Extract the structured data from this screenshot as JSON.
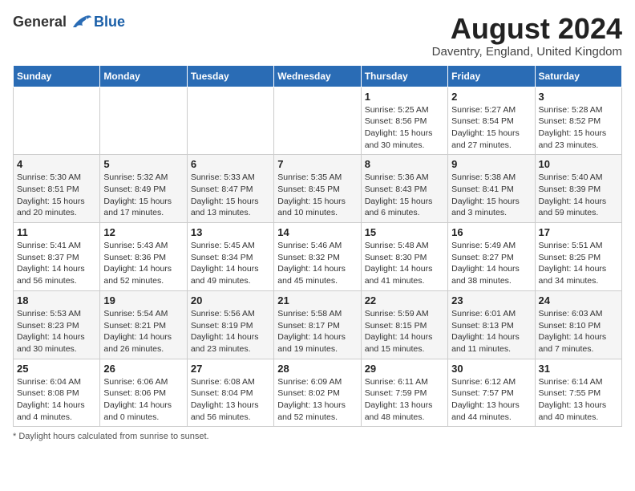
{
  "logo": {
    "general": "General",
    "blue": "Blue"
  },
  "header": {
    "month": "August 2024",
    "location": "Daventry, England, United Kingdom"
  },
  "days_of_week": [
    "Sunday",
    "Monday",
    "Tuesday",
    "Wednesday",
    "Thursday",
    "Friday",
    "Saturday"
  ],
  "weeks": [
    [
      {
        "day": "",
        "info": ""
      },
      {
        "day": "",
        "info": ""
      },
      {
        "day": "",
        "info": ""
      },
      {
        "day": "",
        "info": ""
      },
      {
        "day": "1",
        "info": "Sunrise: 5:25 AM\nSunset: 8:56 PM\nDaylight: 15 hours and 30 minutes."
      },
      {
        "day": "2",
        "info": "Sunrise: 5:27 AM\nSunset: 8:54 PM\nDaylight: 15 hours and 27 minutes."
      },
      {
        "day": "3",
        "info": "Sunrise: 5:28 AM\nSunset: 8:52 PM\nDaylight: 15 hours and 23 minutes."
      }
    ],
    [
      {
        "day": "4",
        "info": "Sunrise: 5:30 AM\nSunset: 8:51 PM\nDaylight: 15 hours and 20 minutes."
      },
      {
        "day": "5",
        "info": "Sunrise: 5:32 AM\nSunset: 8:49 PM\nDaylight: 15 hours and 17 minutes."
      },
      {
        "day": "6",
        "info": "Sunrise: 5:33 AM\nSunset: 8:47 PM\nDaylight: 15 hours and 13 minutes."
      },
      {
        "day": "7",
        "info": "Sunrise: 5:35 AM\nSunset: 8:45 PM\nDaylight: 15 hours and 10 minutes."
      },
      {
        "day": "8",
        "info": "Sunrise: 5:36 AM\nSunset: 8:43 PM\nDaylight: 15 hours and 6 minutes."
      },
      {
        "day": "9",
        "info": "Sunrise: 5:38 AM\nSunset: 8:41 PM\nDaylight: 15 hours and 3 minutes."
      },
      {
        "day": "10",
        "info": "Sunrise: 5:40 AM\nSunset: 8:39 PM\nDaylight: 14 hours and 59 minutes."
      }
    ],
    [
      {
        "day": "11",
        "info": "Sunrise: 5:41 AM\nSunset: 8:37 PM\nDaylight: 14 hours and 56 minutes."
      },
      {
        "day": "12",
        "info": "Sunrise: 5:43 AM\nSunset: 8:36 PM\nDaylight: 14 hours and 52 minutes."
      },
      {
        "day": "13",
        "info": "Sunrise: 5:45 AM\nSunset: 8:34 PM\nDaylight: 14 hours and 49 minutes."
      },
      {
        "day": "14",
        "info": "Sunrise: 5:46 AM\nSunset: 8:32 PM\nDaylight: 14 hours and 45 minutes."
      },
      {
        "day": "15",
        "info": "Sunrise: 5:48 AM\nSunset: 8:30 PM\nDaylight: 14 hours and 41 minutes."
      },
      {
        "day": "16",
        "info": "Sunrise: 5:49 AM\nSunset: 8:27 PM\nDaylight: 14 hours and 38 minutes."
      },
      {
        "day": "17",
        "info": "Sunrise: 5:51 AM\nSunset: 8:25 PM\nDaylight: 14 hours and 34 minutes."
      }
    ],
    [
      {
        "day": "18",
        "info": "Sunrise: 5:53 AM\nSunset: 8:23 PM\nDaylight: 14 hours and 30 minutes."
      },
      {
        "day": "19",
        "info": "Sunrise: 5:54 AM\nSunset: 8:21 PM\nDaylight: 14 hours and 26 minutes."
      },
      {
        "day": "20",
        "info": "Sunrise: 5:56 AM\nSunset: 8:19 PM\nDaylight: 14 hours and 23 minutes."
      },
      {
        "day": "21",
        "info": "Sunrise: 5:58 AM\nSunset: 8:17 PM\nDaylight: 14 hours and 19 minutes."
      },
      {
        "day": "22",
        "info": "Sunrise: 5:59 AM\nSunset: 8:15 PM\nDaylight: 14 hours and 15 minutes."
      },
      {
        "day": "23",
        "info": "Sunrise: 6:01 AM\nSunset: 8:13 PM\nDaylight: 14 hours and 11 minutes."
      },
      {
        "day": "24",
        "info": "Sunrise: 6:03 AM\nSunset: 8:10 PM\nDaylight: 14 hours and 7 minutes."
      }
    ],
    [
      {
        "day": "25",
        "info": "Sunrise: 6:04 AM\nSunset: 8:08 PM\nDaylight: 14 hours and 4 minutes."
      },
      {
        "day": "26",
        "info": "Sunrise: 6:06 AM\nSunset: 8:06 PM\nDaylight: 14 hours and 0 minutes."
      },
      {
        "day": "27",
        "info": "Sunrise: 6:08 AM\nSunset: 8:04 PM\nDaylight: 13 hours and 56 minutes."
      },
      {
        "day": "28",
        "info": "Sunrise: 6:09 AM\nSunset: 8:02 PM\nDaylight: 13 hours and 52 minutes."
      },
      {
        "day": "29",
        "info": "Sunrise: 6:11 AM\nSunset: 7:59 PM\nDaylight: 13 hours and 48 minutes."
      },
      {
        "day": "30",
        "info": "Sunrise: 6:12 AM\nSunset: 7:57 PM\nDaylight: 13 hours and 44 minutes."
      },
      {
        "day": "31",
        "info": "Sunrise: 6:14 AM\nSunset: 7:55 PM\nDaylight: 13 hours and 40 minutes."
      }
    ]
  ],
  "footer": {
    "note": "Daylight hours"
  }
}
